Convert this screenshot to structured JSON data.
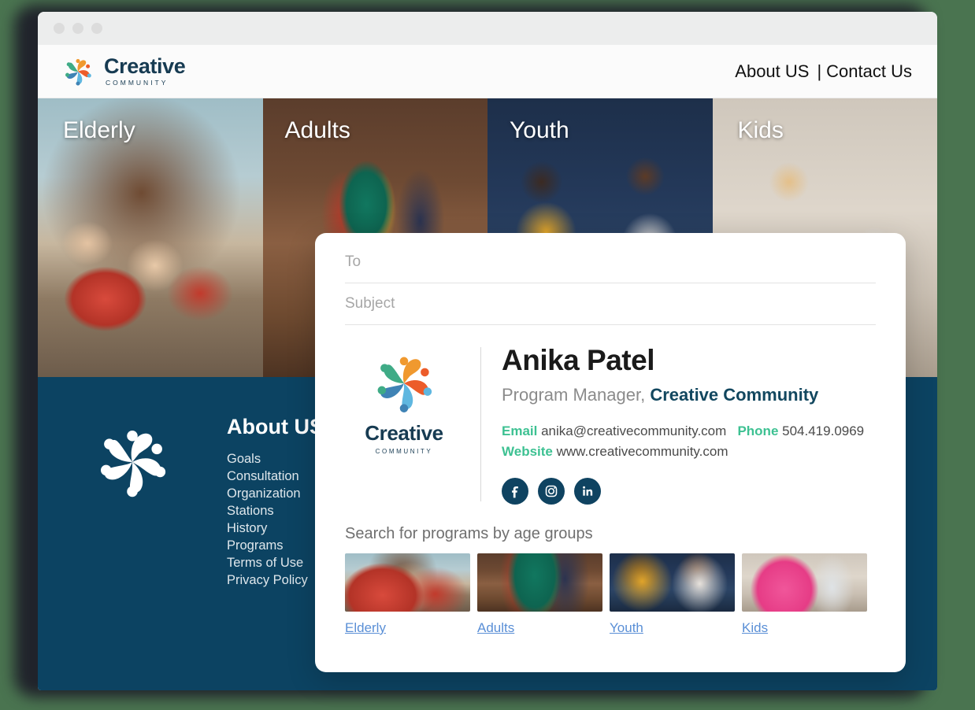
{
  "window": {
    "dots": [
      "minimize-dot",
      "maximize-dot",
      "close-dot"
    ]
  },
  "site_header": {
    "brand": {
      "title": "Creative",
      "subtitle": "COMMUNITY",
      "mark": "creative-community-logo"
    },
    "nav": {
      "about": "About US",
      "separator": "|",
      "contact": "Contact Us"
    }
  },
  "hero": {
    "cells": [
      {
        "label": "Elderly",
        "image": "elderly-art-class-photo"
      },
      {
        "label": "Adults",
        "image": "adults-dance-class-photo"
      },
      {
        "label": "Youth",
        "image": "youth-library-photo"
      },
      {
        "label": "Kids",
        "image": "kids-dance-photo"
      }
    ]
  },
  "footer": {
    "logo": "creative-community-mark-white",
    "title": "About US",
    "links": [
      "Goals",
      "Consultation",
      "Organization",
      "Stations",
      "History",
      "Programs",
      "Terms of Use",
      "Privacy Policy"
    ]
  },
  "email_card": {
    "fields": [
      {
        "name": "to",
        "placeholder": "To",
        "value": ""
      },
      {
        "name": "subject",
        "placeholder": "Subject",
        "value": ""
      }
    ],
    "signature": {
      "logo": {
        "title": "Creative",
        "subtitle": "COMMUNITY"
      },
      "name": "Anika Patel",
      "role_prefix": "Program Manager,",
      "role_org": "Creative Community",
      "email_label": "Email",
      "email_value": "anika@creativecommunity.com",
      "phone_label": "Phone",
      "phone_value": "504.419.0969",
      "website_label": "Website",
      "website_value": "www.creativecommunity.com",
      "socials": [
        {
          "name": "facebook-icon",
          "glyph": "f"
        },
        {
          "name": "instagram-icon",
          "glyph": ""
        },
        {
          "name": "linkedin-icon",
          "glyph": "in"
        }
      ]
    },
    "search": {
      "title": "Search for programs by age groups",
      "thumbs": [
        {
          "label": "Elderly",
          "image": "elderly-art-class-thumb"
        },
        {
          "label": "Adults",
          "image": "adults-dance-thumb"
        },
        {
          "label": "Youth",
          "image": "youth-library-thumb"
        },
        {
          "label": "Kids",
          "image": "kids-dance-thumb"
        }
      ]
    }
  },
  "colors": {
    "page_background": "#4a7450",
    "footer_navy": "#0c4362",
    "brand_navy": "#173b52",
    "accent_green": "#3dc192",
    "link_blue": "#5a8fd6"
  }
}
